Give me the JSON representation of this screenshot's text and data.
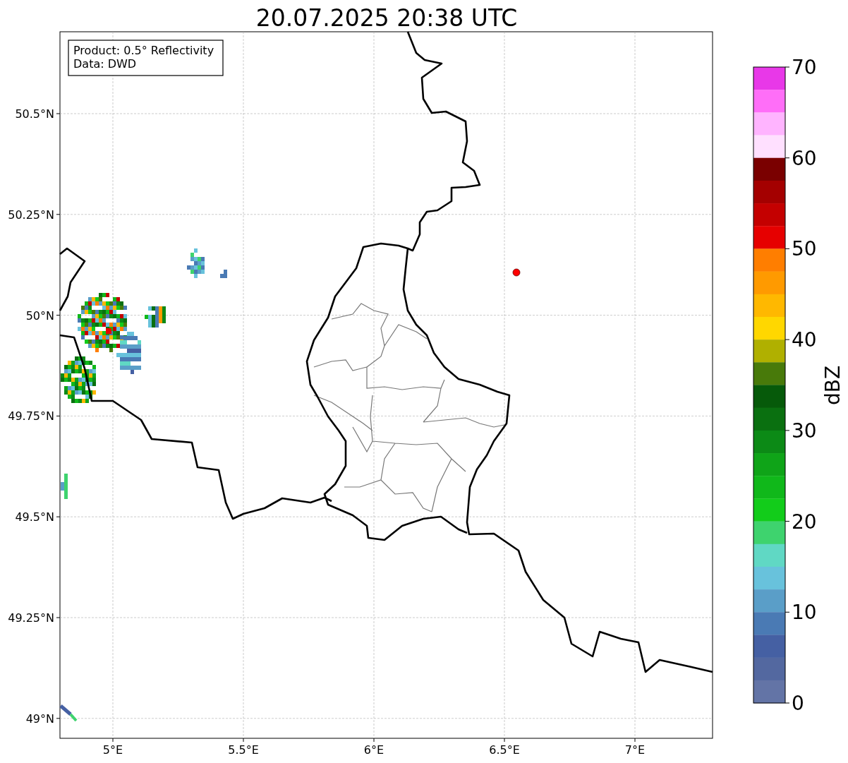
{
  "title": "20.07.2025 20:38 UTC",
  "legend": [
    "Product: 0.5° Reflectivity",
    "Data: DWD"
  ],
  "x_ticks": [
    "5°E",
    "5.5°E",
    "6°E",
    "6.5°E",
    "7°E"
  ],
  "y_ticks": [
    "50.5°N",
    "50.25°N",
    "50°N",
    "49.75°N",
    "49.5°N",
    "49.25°N",
    "49°N"
  ],
  "colorbar": {
    "label": "dBZ",
    "ticks": [
      "70",
      "60",
      "50",
      "40",
      "30",
      "20",
      "10",
      "0"
    ],
    "bins": [
      {
        "color": "#e838e8"
      },
      {
        "color": "#ff6ef8"
      },
      {
        "color": "#ffb4ff"
      },
      {
        "color": "#ffe0ff"
      },
      {
        "color": "#7a0000"
      },
      {
        "color": "#a40000"
      },
      {
        "color": "#c40000"
      },
      {
        "color": "#e60000"
      },
      {
        "color": "#ff7e00"
      },
      {
        "color": "#ff9a00"
      },
      {
        "color": "#ffb800"
      },
      {
        "color": "#ffd700"
      },
      {
        "color": "#b0b000"
      },
      {
        "color": "#487a0a"
      },
      {
        "color": "#065a0a"
      },
      {
        "color": "#0a7010"
      },
      {
        "color": "#0c8a16"
      },
      {
        "color": "#0fa418"
      },
      {
        "color": "#10b81a"
      },
      {
        "color": "#12cc1a"
      },
      {
        "color": "#3ed36e"
      },
      {
        "color": "#60d8c4"
      },
      {
        "color": "#68c2dc"
      },
      {
        "color": "#5a9ec8"
      },
      {
        "color": "#4a7ab4"
      },
      {
        "color": "#4560a3"
      },
      {
        "color": "#5368a0"
      },
      {
        "color": "#6374a6"
      }
    ]
  }
}
